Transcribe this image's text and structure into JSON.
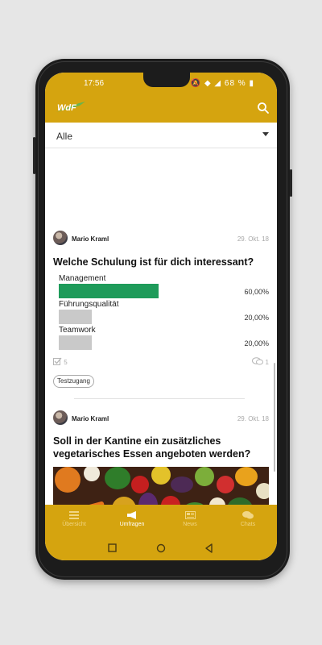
{
  "status": {
    "time": "17:56",
    "icons": "🔕 ◆ ◢ ",
    "battery": "68 %"
  },
  "app": {
    "logo_text": "WdF",
    "accent": "#d5a40f"
  },
  "filter": {
    "selected": "Alle"
  },
  "posts": [
    {
      "author": "Mario Kraml",
      "date": "29. Okt. 18",
      "question": "Welche Schulung ist für dich interessant?",
      "options": [
        {
          "label": "Management",
          "percent": "60,00%",
          "share": 0.6,
          "color": "#1e9b5a"
        },
        {
          "label": "Führungsqualität",
          "percent": "20,00%",
          "share": 0.2,
          "color": "#c9c9c9"
        },
        {
          "label": "Teamwork",
          "percent": "20,00%",
          "share": 0.2,
          "color": "#c9c9c9"
        }
      ],
      "votes": "5",
      "comments": "1",
      "tag": "Testzugang"
    },
    {
      "author": "Mario Kraml",
      "date": "29. Okt. 18",
      "question": "Soll in der Kantine ein zusätzliches vegetarisches Essen angeboten werden?"
    }
  ],
  "nav": [
    {
      "label": "Übersicht",
      "icon": "list-icon"
    },
    {
      "label": "Umfragen",
      "icon": "megaphone-icon",
      "active": true
    },
    {
      "label": "News",
      "icon": "newspaper-icon"
    },
    {
      "label": "Chats",
      "icon": "chat-icon"
    }
  ]
}
